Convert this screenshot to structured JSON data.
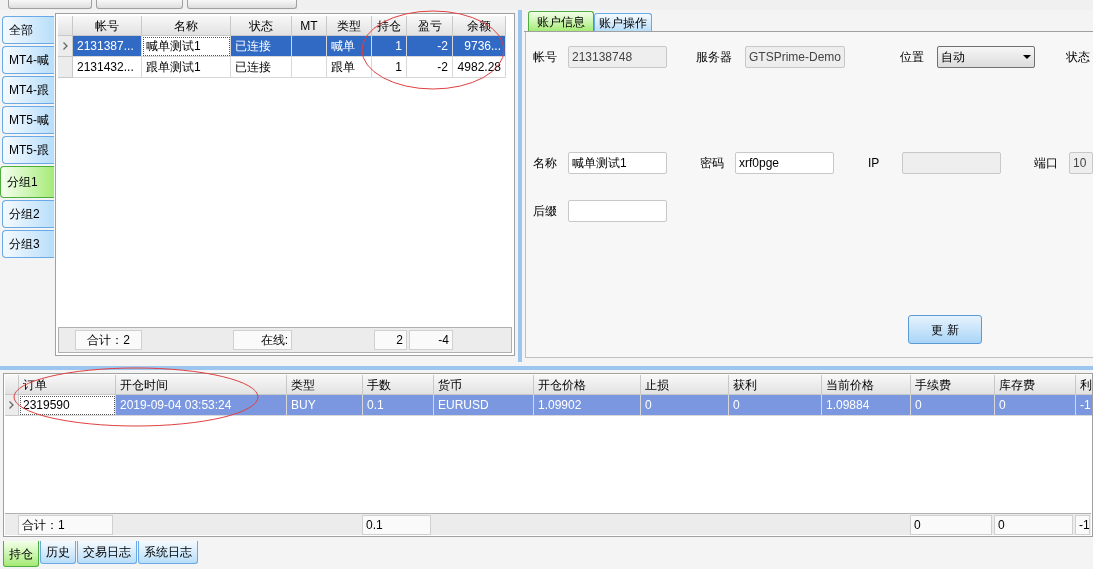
{
  "group_tabs": [
    {
      "label": "全部",
      "selected": false
    },
    {
      "label": "MT4-喊",
      "selected": false
    },
    {
      "label": "MT4-跟",
      "selected": false
    },
    {
      "label": "MT5-喊",
      "selected": false
    },
    {
      "label": "MT5-跟",
      "selected": false
    },
    {
      "label": "分组1",
      "selected": true
    },
    {
      "label": "分组2",
      "selected": false
    },
    {
      "label": "分组3",
      "selected": false
    }
  ],
  "accounts": {
    "columns": [
      "帐号",
      "名称",
      "状态",
      "MT",
      "类型",
      "持仓",
      "盈亏",
      "余额"
    ],
    "rows": [
      {
        "selected": true,
        "cells": [
          {
            "text": "2131387...",
            "focused": false
          },
          {
            "text": "喊单测试1",
            "focused": true
          },
          {
            "text": "已连接",
            "focused": false
          },
          {
            "focused": false
          },
          {
            "text": "喊单",
            "focused": false
          },
          {
            "text": "1",
            "focused": false
          },
          {
            "text": "-2",
            "focused": false
          },
          {
            "text": "9736...",
            "focused": false
          }
        ]
      },
      {
        "selected": false,
        "cells": [
          {
            "text": "2131432...",
            "focused": false
          },
          {
            "text": "跟单测试1",
            "focused": false
          },
          {
            "text": "已连接",
            "focused": false
          },
          {
            "focused": false
          },
          {
            "text": "跟单",
            "focused": false
          },
          {
            "text": "1",
            "focused": false
          },
          {
            "text": "-2",
            "focused": false
          },
          {
            "text": "4982.28",
            "focused": false
          }
        ]
      }
    ],
    "footer": [
      {
        "kind": "text",
        "text": "合计：2"
      },
      {
        "kind": "blank"
      },
      {
        "kind": "text",
        "text": "在线:"
      },
      {
        "kind": "blank"
      },
      {
        "kind": "blank"
      },
      {
        "kind": "text",
        "text": "2"
      },
      {
        "kind": "text",
        "text": "-4"
      },
      {
        "kind": "blank"
      }
    ]
  },
  "detail_tabs": [
    {
      "label": "账户信息",
      "selected": true
    },
    {
      "label": "账户操作",
      "selected": false
    }
  ],
  "form_rows": [
    [
      {
        "kind": "input",
        "label": "帐号",
        "value": "213138748",
        "disabled": true
      },
      {
        "kind": "input",
        "label": "服务器",
        "value": "GTSPrime-Demo",
        "disabled": true
      },
      {
        "kind": "select",
        "label": "位置",
        "value": "自动",
        "disabled": false
      },
      {
        "kind": "label",
        "label": "状态"
      }
    ],
    [
      {
        "kind": "input",
        "label": "名称",
        "value": "喊单测试1",
        "disabled": false
      },
      {
        "kind": "input",
        "label": "密码",
        "value": "xrf0pge",
        "disabled": false
      },
      {
        "kind": "input",
        "label": "IP",
        "disabled": true
      },
      {
        "kind": "input",
        "label": "端口",
        "value": "10",
        "disabled": true
      }
    ],
    [
      {
        "kind": "input",
        "label": "后缀",
        "disabled": false
      }
    ]
  ],
  "update_button": "更 新",
  "positions": {
    "columns": [
      "订单",
      "开仓时间",
      "类型",
      "手数",
      "货币",
      "开仓价格",
      "止损",
      "获利",
      "当前价格",
      "手续费",
      "库存费",
      "利"
    ],
    "rows": [
      {
        "selected": true,
        "cells": [
          {
            "text": "2319590",
            "focused": true
          },
          {
            "text": "2019-09-04 03:53:24",
            "focused": false
          },
          {
            "text": "BUY",
            "focused": false
          },
          {
            "text": "0.1",
            "focused": false
          },
          {
            "text": "EURUSD",
            "focused": false
          },
          {
            "text": "1.09902",
            "focused": false
          },
          {
            "text": "0",
            "focused": false
          },
          {
            "text": "0",
            "focused": false
          },
          {
            "text": "1.09884",
            "focused": false
          },
          {
            "text": "0",
            "focused": false
          },
          {
            "text": "0",
            "focused": false
          },
          {
            "text": "-1",
            "focused": false
          }
        ]
      }
    ],
    "footer": [
      {
        "kind": "text",
        "text": "合计：1"
      },
      {
        "kind": "blank"
      },
      {
        "kind": "blank"
      },
      {
        "kind": "text",
        "text": "0.1"
      },
      {
        "kind": "blank"
      },
      {
        "kind": "blank"
      },
      {
        "kind": "blank"
      },
      {
        "kind": "blank"
      },
      {
        "kind": "blank"
      },
      {
        "kind": "text",
        "text": "0"
      },
      {
        "kind": "text",
        "text": "0"
      },
      {
        "kind": "text",
        "text": "-1"
      }
    ]
  },
  "bottom_tabs": [
    {
      "label": "持仓",
      "selected": true
    },
    {
      "label": "历史",
      "selected": false
    },
    {
      "label": "交易日志",
      "selected": false
    },
    {
      "label": "系统日志",
      "selected": false
    }
  ]
}
